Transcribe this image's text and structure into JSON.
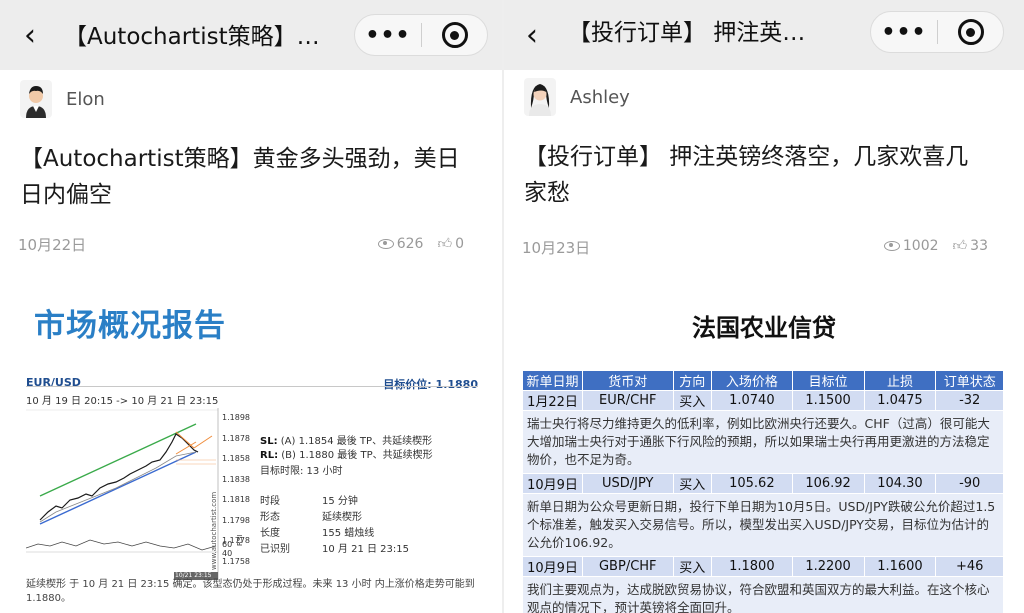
{
  "left": {
    "nav_title": "【Autochartist策略】…",
    "author": "Elon",
    "headline_line1": "【Autochartist策略】黄金多头强劲，美日",
    "headline_line2": "日内偏空",
    "date": "10月22日",
    "views": "626",
    "likes": "0",
    "report_title": "市场概况报告",
    "chart": {
      "pair": "EUR/USD",
      "range": "10 月 19 日 20:15 -> 10 月 21 日 23:15",
      "target": "目标价位: 1.1880",
      "y_ticks": [
        "1.1898",
        "1.1878",
        "1.1858",
        "1.1838",
        "1.1818",
        "1.1798",
        "1.1778",
        "1.1758"
      ],
      "rsi_ticks": [
        "60",
        "40"
      ],
      "rsi_label": "RSI",
      "watermark": "www.autochartist.com",
      "stamp": "10/21 23:15",
      "sl_label": "SL:",
      "sl_text": "(A) 1.1854 最後 TP、共延续楔形",
      "rl_label": "RL:",
      "rl_text": "(B) 1.1880 最後 TP、共延续楔形",
      "target_time": "目标时限: 13 小时",
      "kv": [
        {
          "k": "时段",
          "v": "15 分钟"
        },
        {
          "k": "形态",
          "v": "延续楔形"
        },
        {
          "k": "长度",
          "v": "155 蜡烛线"
        },
        {
          "k": "已识别",
          "v": "10 月 21 日 23:15"
        }
      ],
      "footnote_1": "延续楔形 于 10 月 21 日 23:15 确定。该型态仍处于形成过程。未来 13 小时 内上涨价格走势可能到",
      "footnote_2": "1.1880。"
    }
  },
  "right": {
    "nav_title": "【投行订单】 押注英…",
    "author": "Ashley",
    "headline_line1": "【投行订单】 押注英镑终落空，几家欢喜几",
    "headline_line2": "家愁",
    "date": "10月23日",
    "views": "1002",
    "likes": "33",
    "report_title": "法国农业信贷",
    "table": {
      "headers": [
        "新单日期",
        "货币对",
        "方向",
        "入场价格",
        "目标位",
        "止损",
        "订单状态"
      ],
      "rows": [
        {
          "cells": [
            "1月22日",
            "EUR/CHF",
            "买入",
            "1.0740",
            "1.1500",
            "1.0475",
            "-32"
          ],
          "note": "瑞士央行将尽力维持更久的低利率，例如比欧洲央行还要久。CHF（过高）很可能大大增加瑞士央行对于通胀下行风险的预期，所以如果瑞士央行再用更激进的方法稳定物价，也不足为奇。"
        },
        {
          "cells": [
            "10月9日",
            "USD/JPY",
            "买入",
            "105.62",
            "106.92",
            "104.30",
            "-90"
          ],
          "note": "新单日期为公众号更新日期，投行下单日期为10月5日。USD/JPY跌破公允价超过1.5个标准差，触发买入交易信号。所以，模型发出买入USD/JPY交易，目标位为估计的公允价106.92。"
        },
        {
          "cells": [
            "10月9日",
            "GBP/CHF",
            "买入",
            "1.1800",
            "1.2200",
            "1.1600",
            "+46"
          ],
          "note": "我们主要观点为，达成脱欧贸易协议，符合欧盟和英国双方的最大利益。在这个核心观点的情况下，预计英镑将全面回升。"
        }
      ]
    }
  },
  "colors": {
    "accent_blue": "#2a7fc6",
    "table_header": "#3f6fc2",
    "table_cell": "#d2dcf2",
    "table_note": "#e8edf8"
  }
}
